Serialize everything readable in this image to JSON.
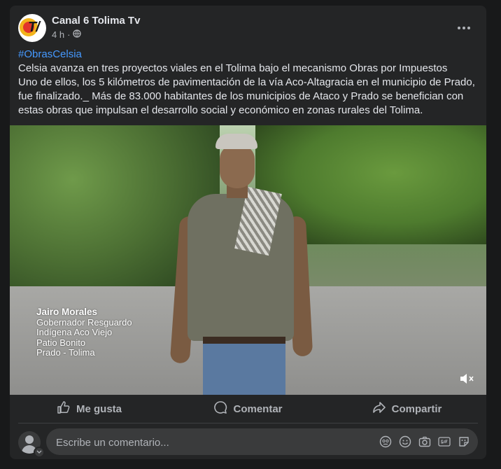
{
  "post": {
    "page_name": "Canal 6 Tolima Tv",
    "time": "4 h",
    "hashtag": "#ObrasCelsia",
    "lines": [
      "Celsia avanza en tres proyectos viales en el Tolima bajo el mecanismo Obras por Impuestos",
      "Uno de ellos, los 5 kilómetros de pavimentación de la vía Aco-Altagracia en el municipio de Prado,",
      "fue finalizado._ Más de 83.000 habitantes de los municipios de Ataco y Prado se benefician con",
      "estas obras que impulsan el desarrollo social y económico en zonas rurales del Tolima."
    ]
  },
  "video": {
    "caption_name": "Jairo Morales",
    "caption_lines": [
      "Gobernador Resguardo",
      "Indígena Aco Viejo",
      "Patio Bonito",
      "Prado - Tolima"
    ]
  },
  "actions": {
    "like": "Me gusta",
    "comment": "Comentar",
    "share": "Compartir"
  },
  "comment": {
    "placeholder": "Escribe un comentario..."
  }
}
